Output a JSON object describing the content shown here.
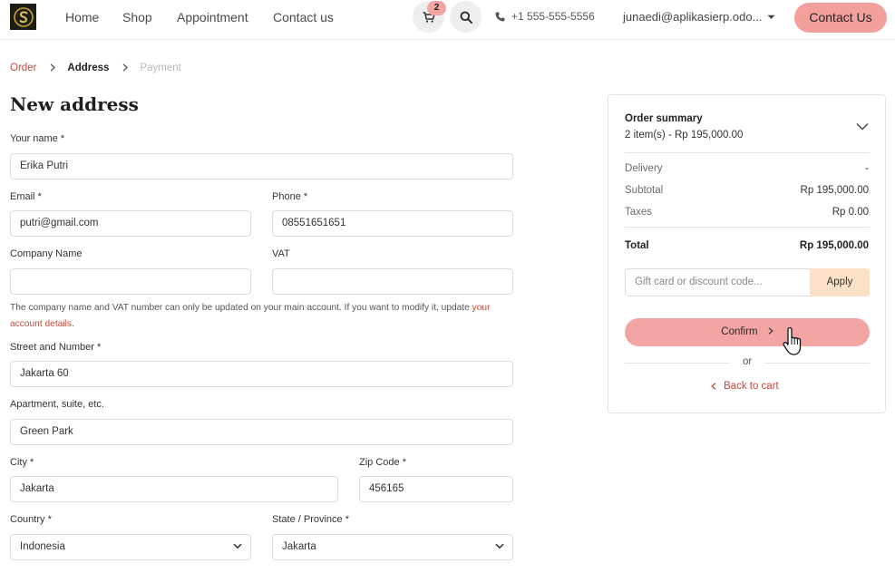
{
  "header": {
    "nav": [
      "Home",
      "Shop",
      "Appointment",
      "Contact us"
    ],
    "cart_count": "2",
    "phone": "+1 555-555-5556",
    "user_email": "junaedi@aplikasierp.odo...",
    "contact_button": "Contact Us",
    "icons": [
      "logo",
      "cart-icon",
      "search-icon",
      "phone-icon",
      "chevron-down-icon"
    ],
    "accent_color": "#f3a09d"
  },
  "breadcrumb": {
    "order": "Order",
    "address": "Address",
    "payment": "Payment"
  },
  "form": {
    "title": "New address",
    "name_label": "Your name *",
    "name_value": "Erika Putri",
    "email_label": "Email *",
    "email_value": "putri@gmail.com",
    "phone_label": "Phone *",
    "phone_value": "08551651651",
    "company_label": "Company Name",
    "company_value": "",
    "vat_label": "VAT",
    "vat_value": "",
    "note_text": "The company name and VAT number can only be updated on your main account. If you want to modify it, update ",
    "note_link": "your account details",
    "note_end": ".",
    "street_label": "Street and Number *",
    "street_value": "Jakarta 60",
    "apartment_label": "Apartment, suite, etc.",
    "apartment_value": "Green Park",
    "city_label": "City *",
    "city_value": "Jakarta",
    "zip_label": "Zip Code *",
    "zip_value": "456165",
    "country_label": "Country *",
    "country_value": "Indonesia",
    "state_label": "State / Province *",
    "state_value": "Jakarta"
  },
  "summary": {
    "title": "Order summary",
    "items": "2 item(s) -  Rp 195,000.00",
    "delivery_label": "Delivery",
    "delivery_value": "-",
    "subtotal_label": "Subtotal",
    "subtotal_value": "Rp 195,000.00",
    "taxes_label": "Taxes",
    "taxes_value": "Rp 0.00",
    "total_label": "Total",
    "total_value": "Rp 195,000.00",
    "discount_placeholder": "Gift card or discount code...",
    "apply_label": "Apply",
    "confirm_label": "Confirm",
    "or_text": "or",
    "back_label": "Back to cart"
  }
}
